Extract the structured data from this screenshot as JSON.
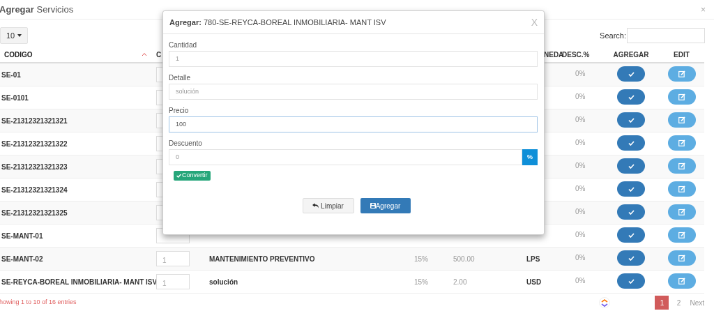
{
  "page": {
    "title": "**Agregar** Servicios",
    "close": "×"
  },
  "length_select": {
    "value": "10"
  },
  "search": {
    "label": "Search:"
  },
  "table": {
    "columns": [
      {
        "label": "CODIGO",
        "sorted": true
      },
      {
        "label": "C",
        "sorted": false
      },
      {
        "label": "NEDA",
        "sorted": false
      },
      {
        "label": "DESC.%",
        "sorted": false
      },
      {
        "label": "AGREGAR",
        "sorted": false
      },
      {
        "label": "EDIT",
        "sorted": false
      }
    ],
    "rows": [
      {
        "codigo": "SE-01",
        "desc": "0%"
      },
      {
        "codigo": "SE-0101",
        "desc": "0%"
      },
      {
        "codigo": "SE-21312321321321",
        "desc": "0%"
      },
      {
        "codigo": "SE-21312321321322",
        "desc": "0%"
      },
      {
        "codigo": "SE-21312321321323",
        "desc": "0%"
      },
      {
        "codigo": "SE-21312321321324",
        "desc": "0%"
      },
      {
        "codigo": "SE-21312321321325",
        "desc": "0%"
      },
      {
        "codigo": "SE-MANT-01",
        "desc": "0%"
      },
      {
        "codigo": "SE-MANT-02",
        "cantidad": "1",
        "detalle": "MANTENIMIENTO PREVENTIVO",
        "isv": "15%",
        "precio": "500.00",
        "moneda": "LPS",
        "desc": "0%"
      },
      {
        "codigo": "SE-REYCA-BOREAL INMOBILIARIA- MANT ISV",
        "cantidad": "1",
        "detalle": "solución",
        "isv": "15%",
        "precio": "2.00",
        "moneda": "USD",
        "desc": "0%"
      }
    ]
  },
  "footer": {
    "info": "howing 1 to 10 of 16 entries",
    "pages": [
      {
        "label": "1",
        "selected": true
      },
      {
        "label": "2",
        "selected": false
      }
    ],
    "next": "Next"
  },
  "modal": {
    "title": "**Agregar:** 780-SE-REYCA-BOREAL INMOBILIARIA- MANT ISV",
    "close": "X",
    "fields": [
      {
        "kind": "text",
        "label": "Cantidad",
        "value": "1",
        "focused": false
      },
      {
        "kind": "text",
        "label": "Detalle",
        "value": "solución",
        "focused": false
      },
      {
        "kind": "text",
        "label": "Precio",
        "value": "100",
        "focused": true
      },
      {
        "kind": "addon",
        "label": "Descuento",
        "value": "0",
        "addon": "%",
        "focused": false
      }
    ],
    "convert_button": "Convertir",
    "buttons": [
      {
        "kind": "reset",
        "label": "Limpiar"
      },
      {
        "kind": "save",
        "label": "Agregar"
      }
    ]
  }
}
